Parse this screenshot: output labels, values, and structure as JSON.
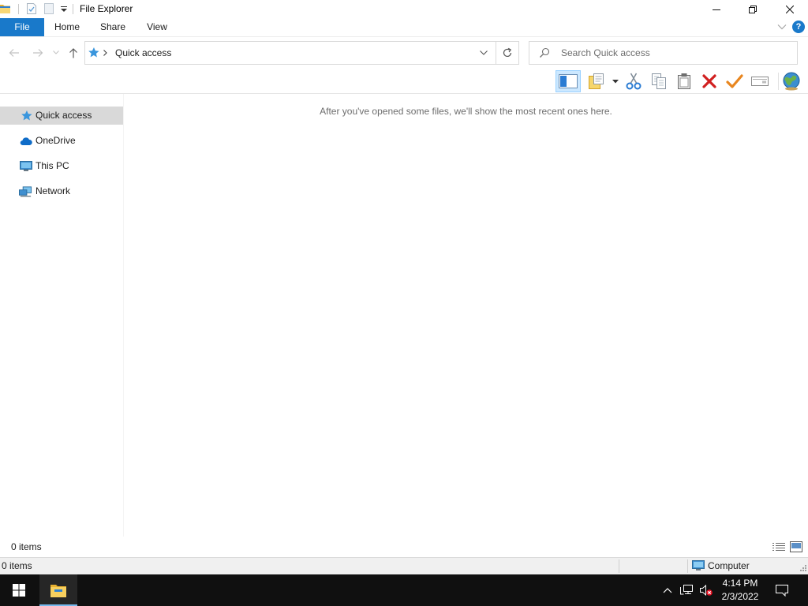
{
  "window": {
    "title": "File Explorer",
    "quick_access_toolbar": [
      "folder-app-icon",
      "properties-icon",
      "new-folder-icon",
      "customize-dropdown-icon"
    ],
    "controls": [
      "minimize-icon",
      "restore-icon",
      "close-icon"
    ]
  },
  "ribbon": {
    "tabs": [
      {
        "label": "File"
      },
      {
        "label": "Home"
      },
      {
        "label": "Share"
      },
      {
        "label": "View"
      }
    ],
    "help_label": "?"
  },
  "address": {
    "path": [
      "Quick access"
    ],
    "location_icon": "star-icon",
    "search_placeholder": "Search Quick access"
  },
  "toolbar": {
    "buttons": [
      {
        "icon": "preview-pane-icon",
        "active": true
      },
      {
        "icon": "notes-folder-icon"
      },
      {
        "icon": "dropdown-arrow-icon"
      },
      {
        "icon": "scissors-icon"
      },
      {
        "icon": "copy-icon"
      },
      {
        "icon": "paste-icon"
      },
      {
        "icon": "delete-x-icon"
      },
      {
        "icon": "checkmark-icon"
      },
      {
        "icon": "rename-icon"
      },
      {
        "icon": "globe-icon"
      }
    ]
  },
  "navigation": {
    "items": [
      {
        "label": "Quick access",
        "icon": "star-icon",
        "selected": true
      },
      {
        "label": "OneDrive",
        "icon": "cloud-icon"
      },
      {
        "label": "This PC",
        "icon": "computer-icon"
      },
      {
        "label": "Network",
        "icon": "network-icon"
      }
    ]
  },
  "content": {
    "empty_message": "After you've opened some files, we'll show the most recent ones here."
  },
  "status_bar": {
    "item_count": "0 items",
    "view_buttons": [
      "details-view-icon",
      "large-icons-view-icon"
    ]
  },
  "classic_status_bar": {
    "item_count": "0 items",
    "zone": "Computer"
  },
  "taskbar": {
    "pinned": [
      {
        "icon": "file-explorer-icon",
        "active": true
      }
    ],
    "tray_icons": [
      "chevron-up-icon",
      "network-wired-icon",
      "volume-muted-icon",
      "notification-icon"
    ],
    "time": "4:14 PM",
    "date": "2/3/2022"
  },
  "colors": {
    "accent": "#1979ca",
    "nav_selection": "#d9d9d9",
    "toolbar_active": "#cce8ff",
    "taskbar": "#101010",
    "taskbar_active_indicator": "#76b9ed",
    "delete": "#d12020",
    "check": "#e8861f"
  }
}
